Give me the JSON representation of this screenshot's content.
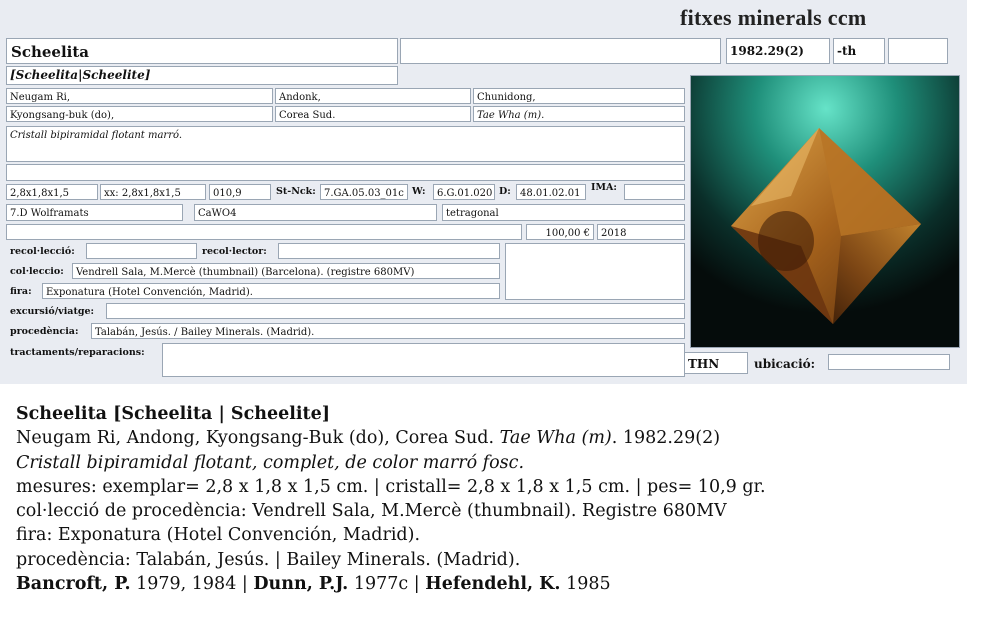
{
  "header": {
    "title": "fitxes minerals ccm"
  },
  "card": {
    "species": "Scheelita",
    "reg_number": "1982.29(2)",
    "size_code": "-th",
    "synonyms": "[Scheelita|Scheelite]",
    "locality": [
      "Neugam Ri,",
      "Andonk,",
      "Chunidong,"
    ],
    "region": [
      "Kyongsang-buk (do),",
      "Corea Sud.",
      "Tae Wha (m)."
    ],
    "short_desc": "Cristall bipiramidal flotant marró.",
    "measures": {
      "specimen": "2,8x1,8x1,5",
      "crystal": "xx: 2,8x1,8x1,5",
      "weight": "010,9",
      "strunz_label": "St-Nck:",
      "strunz": "7.GA.05.03_01c",
      "w_label": "W:",
      "w": "6.G.01.020",
      "d_label": "D:",
      "d": "48.01.02.01",
      "ima_label": "IMA:"
    },
    "class": "7.D Wolframats",
    "formula": "CaWO4",
    "system": "tetragonal",
    "price": "100,00 €",
    "year": "2018",
    "labels": {
      "collection_place": "recol·lecció:",
      "collector": "recol·lector:",
      "collection": "col·leccio:",
      "fair": "fira:",
      "trip": "excursió/viatge:",
      "provenance": "procedència:",
      "treatments": "tractaments/reparacions:",
      "location": "ubicació:"
    },
    "collection": "Vendrell Sala, M.Mercè (thumbnail) (Barcelona). (registre 680MV)",
    "fair": "Exponatura (Hotel Convención, Madrid).",
    "provenance": "Talabán, Jesús. / Bailey Minerals. (Madrid).",
    "thn": "THN"
  },
  "description": {
    "heading": "Scheelita [Scheelita | Scheelite]",
    "locality_text": "Neugam Ri, Andong, Kyongsang-Buk (do), Corea Sud.",
    "mine": "Tae Wha (m)",
    "locality_suffix": ". 1982.29(2)",
    "crystal_desc": "Cristall bipiramidal flotant, complet, de color marró fosc.",
    "measures": "mesures: exemplar= 2,8 x 1,8 x 1,5 cm. | cristall= 2,8 x 1,8 x 1,5 cm. | pes= 10,9 gr.",
    "collection": "col·lecció de procedència: Vendrell Sala, M.Mercè (thumbnail). Registre 680MV",
    "fair": "fira: Exponatura (Hotel Convención, Madrid).",
    "provenance": "procedència: Talabán, Jesús. | Bailey Minerals. (Madrid).",
    "refs": [
      {
        "author": "Bancroft, P.",
        "years": " 1979, 1984"
      },
      {
        "sep": " | "
      },
      {
        "author": "Dunn, P.J.",
        "years": " 1977c"
      },
      {
        "sep": " | "
      },
      {
        "author": "Hefendehl, K.",
        "years": " 1985"
      }
    ]
  }
}
